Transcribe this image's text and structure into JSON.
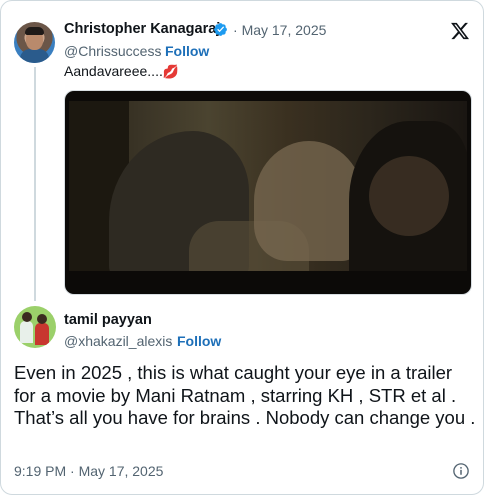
{
  "quoted_tweet": {
    "author_name": "Christopher Kanagaraj",
    "verified": true,
    "date": "May 17, 2025",
    "handle": "@Chrissuccess",
    "separator": "·",
    "follow_label": "Follow",
    "text": "Aandavareee....",
    "emoji": "💋",
    "media_type": "video-still"
  },
  "platform_icon": "x-logo-icon",
  "main_tweet": {
    "author_name": "tamil payyan",
    "handle": "@xhakazil_alexis",
    "separator": "·",
    "follow_label": "Follow",
    "text": "Even in 2025 , this is what caught your eye in a trailer for a movie by Mani Ratnam , starring KH , STR et al . That’s all you have for brains . Nobody can change you .",
    "timestamp": "9:19 PM · May 17, 2025"
  },
  "colors": {
    "link_blue": "#1d6fb8",
    "muted_text": "#536471",
    "verified_blue": "#1d9bf0",
    "border": "#cfd9de"
  }
}
